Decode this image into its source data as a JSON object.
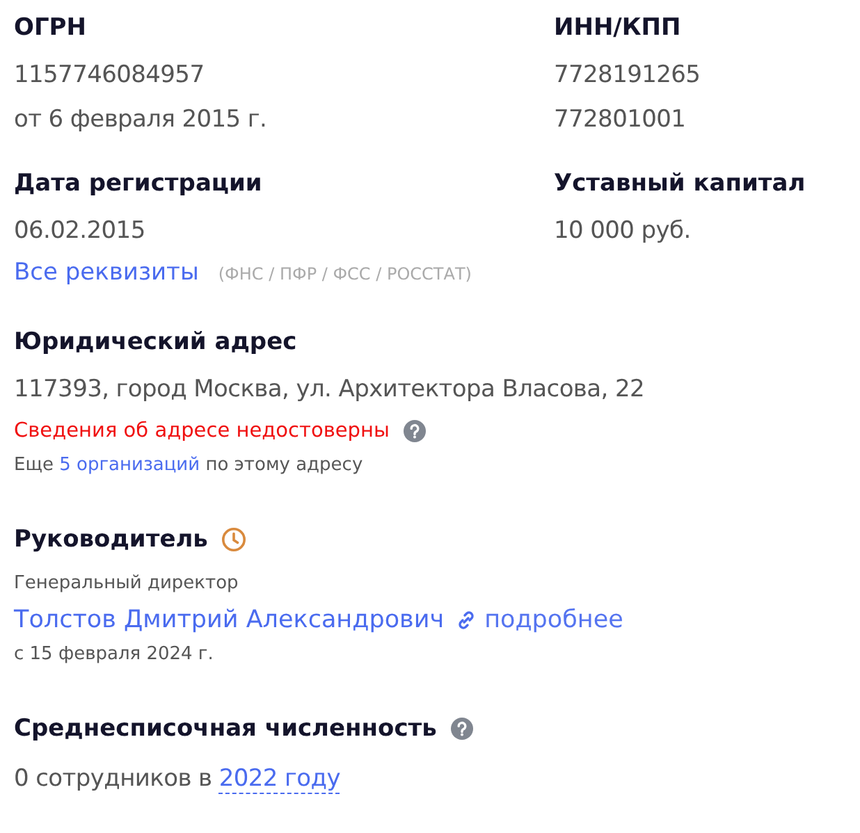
{
  "requisites": [
    {
      "label": "ОГРН",
      "values": [
        "1157746084957",
        "от 6 февраля 2015 г."
      ]
    },
    {
      "label": "ИНН/КПП",
      "values": [
        "7728191265",
        "772801001"
      ]
    },
    {
      "label": "Дата регистрации",
      "values": [
        "06.02.2015"
      ]
    },
    {
      "label": "Уставный капитал",
      "values": [
        "10 000 руб."
      ]
    }
  ],
  "all_requisites": {
    "link": "Все реквизиты",
    "note": "(ФНС / ПФР / ФСС / РОССТАТ)"
  },
  "address": {
    "heading": "Юридический адрес",
    "value": "117393, город Москва, ул. Архитектора Власова, 22",
    "warning": "Сведения об адресе недостоверны",
    "more_before": "Еще",
    "more_link": "5 организаций",
    "more_after": "по этому адресу"
  },
  "director": {
    "heading": "Руководитель",
    "position": "Генеральный директор",
    "name": "Толстов Дмитрий Александрович",
    "details_link": "подробнее",
    "since": "с 15 февраля 2024 г."
  },
  "headcount": {
    "heading": "Среднесписочная численность",
    "before": "0 сотрудников в",
    "year_link": "2022 году"
  }
}
